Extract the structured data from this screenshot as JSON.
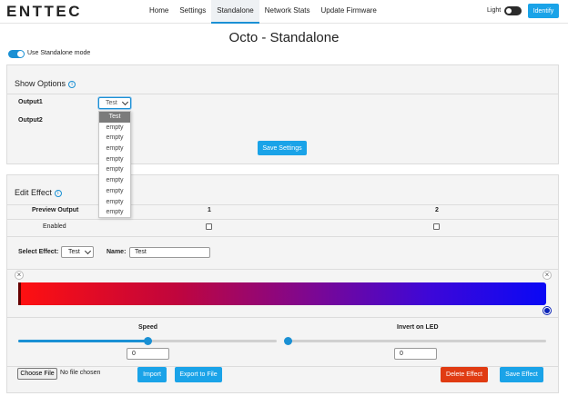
{
  "header": {
    "logo_text": "ENTTEC",
    "nav": [
      "Home",
      "Settings",
      "Standalone",
      "Network Stats",
      "Update Firmware"
    ],
    "active_nav": "Standalone",
    "theme_label": "Light",
    "identify_label": "Identify"
  },
  "page_title": "Octo - Standalone",
  "standalone_mode": {
    "label": "Use Standalone mode",
    "enabled": true
  },
  "show_options": {
    "heading": "Show Options",
    "output1_label": "Output1",
    "output1_value": "Test",
    "output2_label": "Output2",
    "save_label": "Save Settings",
    "dropdown_options": [
      "Test",
      "empty",
      "empty",
      "empty",
      "empty",
      "empty",
      "empty",
      "empty",
      "empty",
      "empty"
    ]
  },
  "edit_effect": {
    "heading": "Edit Effect",
    "preview_output_label": "Preview Output",
    "output_col_1": "1",
    "output_col_2": "2",
    "enabled_label": "Enabled",
    "select_effect_label": "Select Effect:",
    "select_effect_value": "Test",
    "name_label": "Name:",
    "name_value": "Test",
    "gradient_start_color": "#ff1010",
    "gradient_end_color": "#0a08f5",
    "speed_label": "Speed",
    "speed_value": "0",
    "speed_fraction": 0.5,
    "invert_label": "Invert on LED",
    "invert_value": "0",
    "invert_fraction": 0.0,
    "choose_file_label": "Choose File",
    "no_file_label": "No file chosen",
    "import_label": "Import",
    "export_label": "Export to File",
    "delete_label": "Delete Effect",
    "save_effect_label": "Save Effect"
  },
  "colors": {
    "accent": "#1a90d4",
    "button_blue": "#1aa3e8",
    "danger": "#e03b12"
  }
}
